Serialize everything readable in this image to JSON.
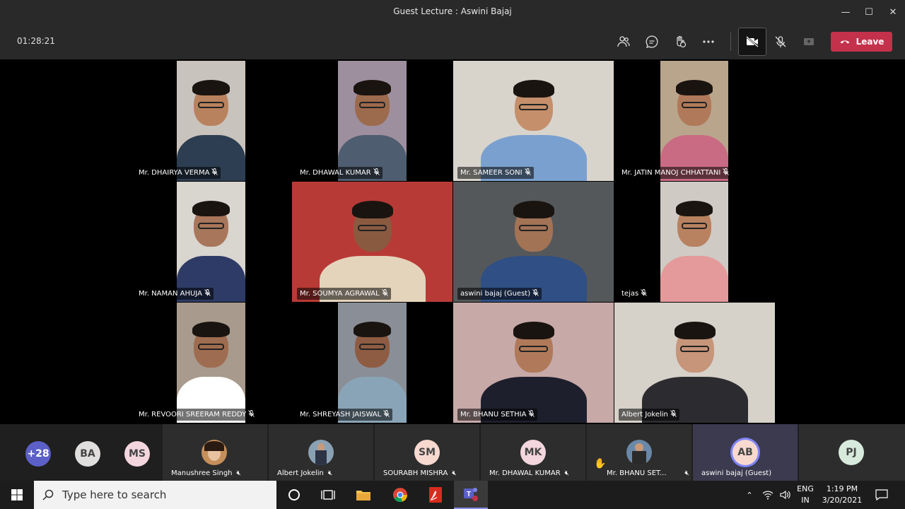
{
  "window": {
    "title": "Guest Lecture : Aswini Bajaj",
    "controls": [
      "minimize",
      "maximize",
      "close"
    ]
  },
  "toolbar": {
    "timer": "01:28:21",
    "buttons": [
      "participants-icon",
      "chat-icon",
      "raise-hand-icon",
      "more-icon",
      "camera-off-icon",
      "mic-off-icon",
      "share-icon"
    ],
    "leave_label": "Leave",
    "leave_color": "#c4314b"
  },
  "tiles": [
    {
      "name": "Mr. DHAIRYA VERMA",
      "bg": "#c9c3bd"
    },
    {
      "name": "Mr. DHAWAL KUMAR",
      "bg": "#9e8f9e"
    },
    {
      "name": "Mr. SAMEER SONI",
      "bg": "#d8d4cc"
    },
    {
      "name": "Mr. JATIN MANOJ CHHATTANI",
      "bg": "#b9a58c"
    },
    {
      "name": "Mr. NAMAN AHUJA",
      "bg": "#d9d5cf"
    },
    {
      "name": "Mr. SOUMYA AGRAWAL",
      "bg": "#b83a36"
    },
    {
      "name": "aswini bajaj (Guest)",
      "bg": "#55585a"
    },
    {
      "name": "tejas",
      "bg": "#cfcac4"
    },
    {
      "name": "Mr. REVOORI SREERAM REDDY",
      "bg": "#a89a8c"
    },
    {
      "name": "Mr. SHREYASH JAISWAL",
      "bg": "#8a8e96"
    },
    {
      "name": "Mr. BHANU SETHIA",
      "bg": "#c7a9a8"
    },
    {
      "name": "Albert Jokelin",
      "bg": "#d6d1c9"
    }
  ],
  "strip": {
    "overflow": "+28",
    "initials": [
      {
        "text": "BA",
        "bg": "#e1dfdd",
        "fg": "#444"
      },
      {
        "text": "MS",
        "bg": "#f4d6df",
        "fg": "#444"
      }
    ],
    "participants": [
      {
        "name": "Manushree Singh",
        "type": "photo"
      },
      {
        "name": "Albert Jokelin",
        "type": "photo"
      },
      {
        "name": "SOURABH MISHRA",
        "type": "initials",
        "initials": "SM",
        "bg": "#f7d9d0"
      },
      {
        "name": "Mr. DHAWAL KUMAR",
        "type": "initials",
        "initials": "MK",
        "bg": "#f4d6df"
      },
      {
        "name": "Mr. BHANU SET...",
        "type": "photo",
        "hand": true
      },
      {
        "name": "aswini bajaj (Guest)",
        "type": "initials",
        "initials": "AB",
        "bg": "#f7d9d0"
      },
      {
        "name": "",
        "type": "initials",
        "initials": "PJ",
        "bg": "#d7eadc"
      }
    ]
  },
  "taskbar": {
    "search_placeholder": "Type here to search",
    "lang1": "ENG",
    "lang2": "IN",
    "time": "1:19 PM",
    "date": "3/20/2021"
  }
}
